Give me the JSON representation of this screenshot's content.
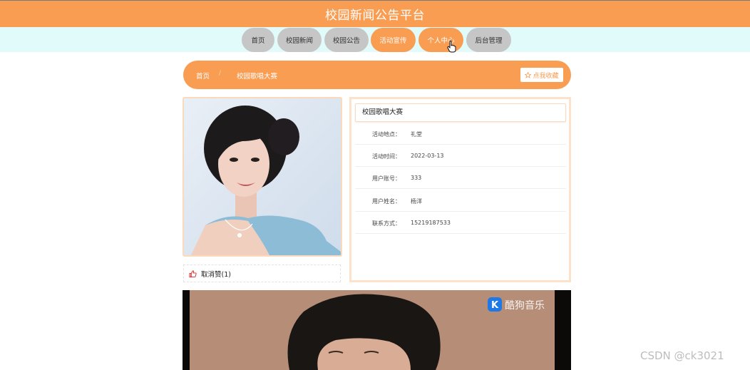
{
  "header": {
    "title": "校园新闻公告平台"
  },
  "nav": {
    "items": [
      {
        "label": "首页",
        "active": false
      },
      {
        "label": "校园新闻",
        "active": false
      },
      {
        "label": "校园公告",
        "active": false
      },
      {
        "label": "活动宣传",
        "active": true
      },
      {
        "label": "个人中心",
        "active": true
      },
      {
        "label": "后台管理",
        "active": false
      }
    ]
  },
  "breadcrumb": {
    "home": "首页",
    "separator": "/",
    "current": "校园歌唱大赛",
    "favorite_label": "点我收藏",
    "favorite_icon": "star-outline-icon"
  },
  "detail": {
    "title": "校园歌唱大赛",
    "rows": [
      {
        "label": "活动地点：",
        "value": "礼堂"
      },
      {
        "label": "活动时间：",
        "value": "2022-03-13"
      },
      {
        "label": "用户账号：",
        "value": "333"
      },
      {
        "label": "用户姓名：",
        "value": "杨洋"
      },
      {
        "label": "联系方式：",
        "value": "15219187533"
      }
    ]
  },
  "like": {
    "label": "取消赞(1)",
    "icon": "thumbs-up-icon",
    "color": "#e02020"
  },
  "video": {
    "logo_text": "酷狗音乐",
    "logo_letter": "K"
  },
  "watermark": "CSDN @ck3021",
  "colors": {
    "primary": "#f99d53",
    "nav_bg": "#e1fbfb",
    "nav_inactive": "#c6c6c6"
  }
}
